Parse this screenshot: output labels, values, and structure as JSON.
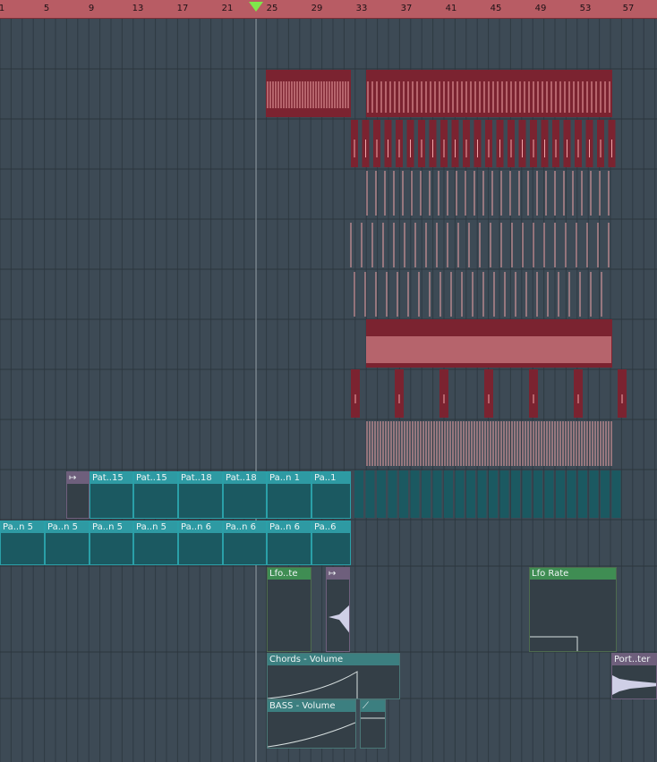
{
  "ruler": {
    "bars": [
      "1",
      "5",
      "9",
      "13",
      "17",
      "21",
      "25",
      "29",
      "33",
      "37",
      "41",
      "45",
      "49",
      "53",
      "57"
    ]
  },
  "playhead": {
    "icon": "playhead-triangle-icon",
    "color": "#7ee84b"
  },
  "colors": {
    "background": "#3d4a55",
    "ruler": "#b85c64",
    "audio_clip": "#7b2330",
    "waveform": "#f0a4a8",
    "pattern_clip": "#1b5961",
    "pattern_header": "#2e9aa3",
    "automation_header": "#3f8d53"
  },
  "tracks": {
    "pattern_row_1": {
      "clips": [
        "Pat..15",
        "Pat..15",
        "Pat..18",
        "Pat..18",
        "Pa..n 1",
        "Pa..1"
      ]
    },
    "pattern_row_2": {
      "clips": [
        "Pa..n 5",
        "Pa..n 5",
        "Pa..n 5",
        "Pa..n 5",
        "Pa..n 6",
        "Pa..n 6",
        "Pa..n 6",
        "Pa..6"
      ]
    },
    "automation": {
      "lfo_clip_1": "Lfo..te",
      "lfo_clip_2": "Lfo Rate",
      "chords_volume": "Chords - Volume",
      "bass_volume": "BASS - Volume",
      "port_clip": "Port..ter"
    }
  }
}
